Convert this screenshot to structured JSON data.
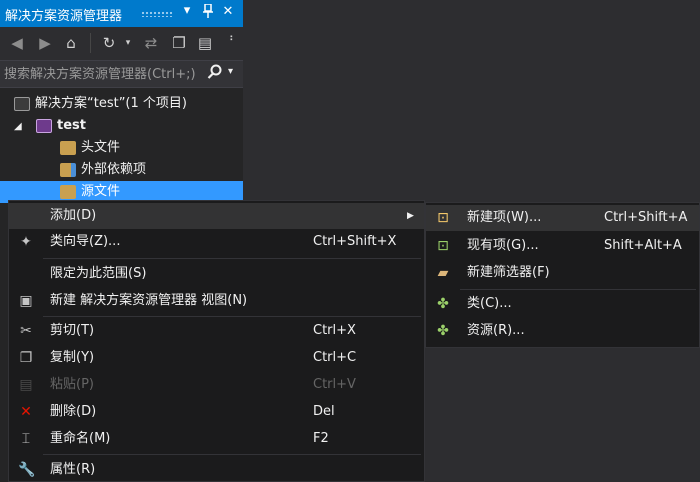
{
  "panel": {
    "title": "解决方案资源管理器",
    "title_icons": {
      "dropdown": "▾",
      "pin": "📌",
      "close": "✕"
    },
    "search_placeholder": "搜索解决方案资源管理器(Ctrl+;)",
    "search_icon": "magnifier-icon"
  },
  "tree": {
    "solution": "解决方案“test”(1 个项目)",
    "project": "test",
    "items": [
      {
        "label": "头文件"
      },
      {
        "label": "外部依赖项"
      },
      {
        "label": "源文件"
      }
    ]
  },
  "context_menu": [
    {
      "label": "添加(D)",
      "shortcut": "",
      "has_submenu": true,
      "icon": ""
    },
    {
      "label": "类向导(Z)...",
      "shortcut": "Ctrl+Shift+X",
      "icon": "class-wizard-icon"
    },
    {
      "label": "限定为此范围(S)",
      "shortcut": "",
      "icon": ""
    },
    {
      "label": "新建 解决方案资源管理器 视图(N)",
      "shortcut": "",
      "icon": "new-view-icon"
    },
    {
      "label": "剪切(T)",
      "shortcut": "Ctrl+X",
      "icon": "cut-icon"
    },
    {
      "label": "复制(Y)",
      "shortcut": "Ctrl+C",
      "icon": "copy-icon"
    },
    {
      "label": "粘贴(P)",
      "shortcut": "Ctrl+V",
      "icon": "paste-icon",
      "disabled": true
    },
    {
      "label": "删除(D)",
      "shortcut": "Del",
      "icon": "delete-icon"
    },
    {
      "label": "重命名(M)",
      "shortcut": "F2",
      "icon": "rename-icon"
    },
    {
      "label": "属性(R)",
      "shortcut": "",
      "icon": "properties-icon"
    }
  ],
  "submenu": [
    {
      "label": "新建项(W)...",
      "shortcut": "Ctrl+Shift+A",
      "icon": "new-item-icon"
    },
    {
      "label": "现有项(G)...",
      "shortcut": "Shift+Alt+A",
      "icon": "existing-item-icon"
    },
    {
      "label": "新建筛选器(F)",
      "shortcut": "",
      "icon": "new-filter-icon"
    },
    {
      "label": "类(C)...",
      "shortcut": "",
      "icon": "class-icon"
    },
    {
      "label": "资源(R)...",
      "shortcut": "",
      "icon": "resource-icon"
    }
  ],
  "colors": {
    "accent": "#007acc",
    "selection": "#3399ff",
    "menu_bg": "#1b1b1c",
    "panel_bg": "#252526",
    "editor_bg": "#2d2d30"
  }
}
